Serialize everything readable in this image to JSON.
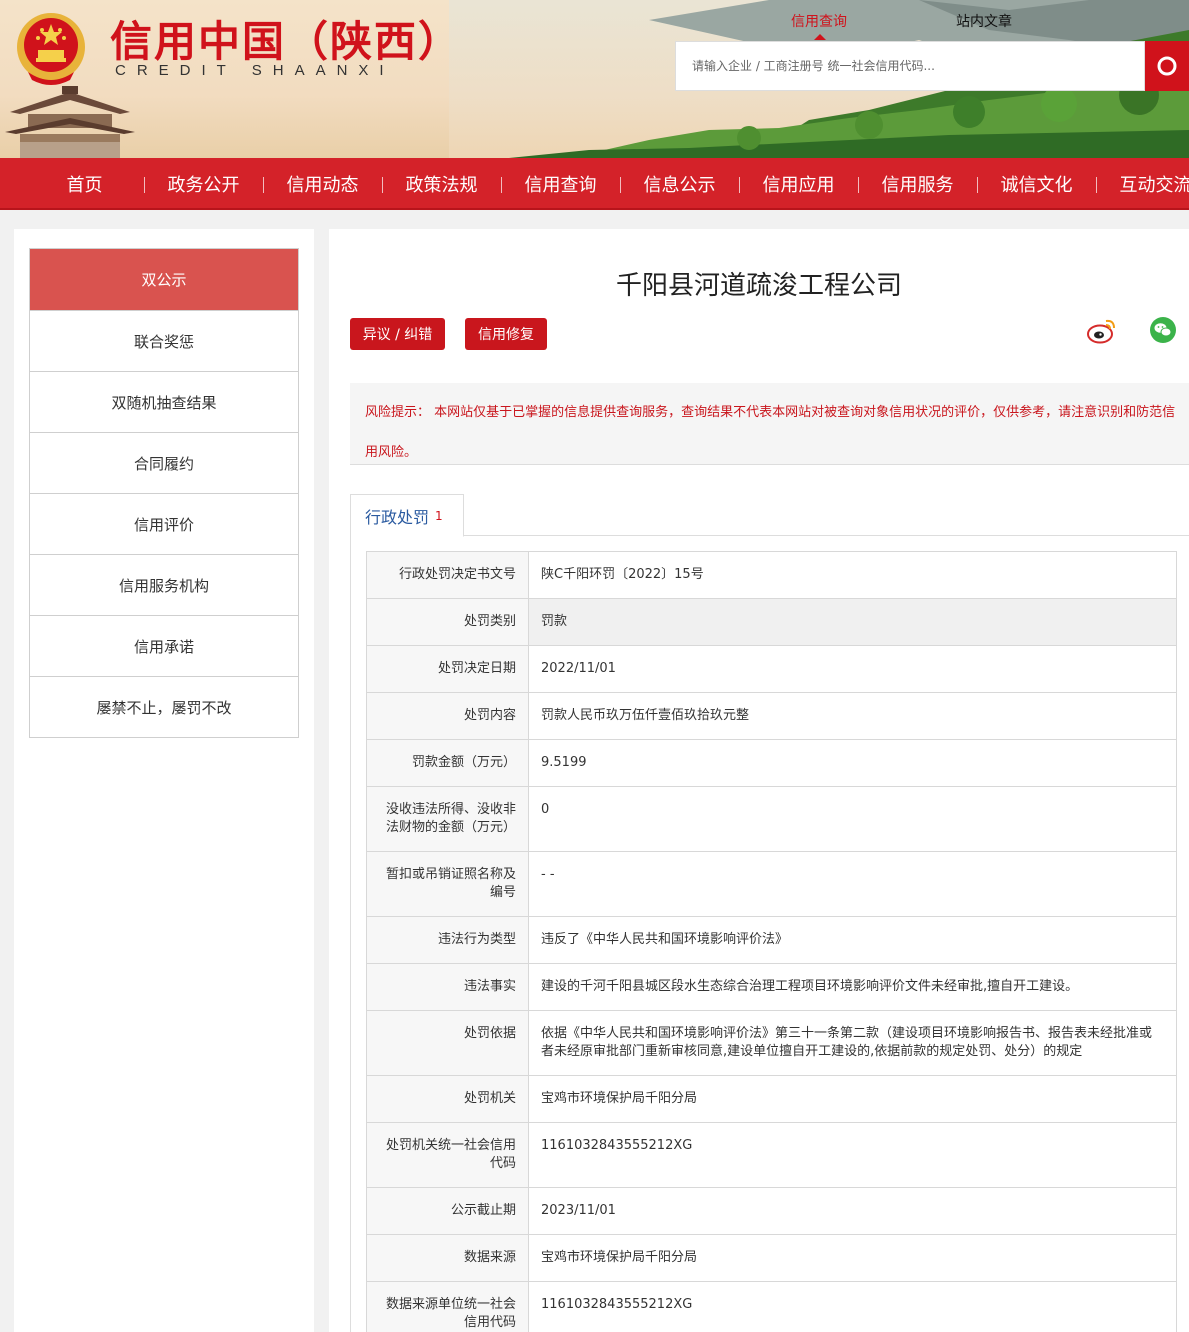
{
  "header": {
    "site_title": "信用中国（陕西）",
    "site_subtitle": "CREDIT SHAANXI",
    "search_tabs": [
      "信用查询",
      "站内文章"
    ],
    "search_placeholder": "请输入企业 / 工商注册号 统一社会信用代码...",
    "search_icon": "search-icon"
  },
  "nav": {
    "items": [
      "首页",
      "政务公开",
      "信用动态",
      "政策法规",
      "信用查询",
      "信息公示",
      "信用应用",
      "信用服务",
      "诚信文化",
      "互动交流"
    ]
  },
  "sidebar": {
    "items": [
      "双公示",
      "联合奖惩",
      "双随机抽查结果",
      "合同履约",
      "信用评价",
      "信用服务机构",
      "信用承诺",
      "屡禁不止，屡罚不改"
    ],
    "active_index": 0
  },
  "main": {
    "company_name": "千阳县河道疏浚工程公司",
    "buttons": {
      "objection": "异议 / 纠错",
      "repair": "信用修复"
    },
    "share_icons": [
      "weibo-icon",
      "wechat-icon"
    ],
    "risk_notice": "风险提示： 本网站仅基于已掌握的信息提供查询服务，查询结果不代表本网站对被查询对象信用状况的评价，仅供参考，请注意识别和防范信用风险。",
    "tab": {
      "label": "行政处罚",
      "count": "1"
    },
    "details": [
      {
        "key": "行政处罚决定书文号",
        "value": "陕C千阳环罚〔2022〕15号"
      },
      {
        "key": "处罚类别",
        "value": "罚款"
      },
      {
        "key": "处罚决定日期",
        "value": "2022/11/01"
      },
      {
        "key": "处罚内容",
        "value": "罚款人民币玖万伍仟壹佰玖拾玖元整"
      },
      {
        "key": "罚款金额（万元）",
        "value": "9.5199"
      },
      {
        "key": "没收违法所得、没收非法财物的金额（万元）",
        "value": "0"
      },
      {
        "key": "暂扣或吊销证照名称及编号",
        "value": "- -"
      },
      {
        "key": "违法行为类型",
        "value": "违反了《中华人民共和国环境影响评价法》"
      },
      {
        "key": "违法事实",
        "value": "建设的千河千阳县城区段水生态综合治理工程项目环境影响评价文件未经审批,擅自开工建设。"
      },
      {
        "key": "处罚依据",
        "value": "依据《中华人民共和国环境影响评价法》第三十一条第二款（建设项目环境影响报告书、报告表未经批准或者未经原审批部门重新审核同意,建设单位擅自开工建设的,依据前款的规定处罚、处分）的规定"
      },
      {
        "key": "处罚机关",
        "value": "宝鸡市环境保护局千阳分局"
      },
      {
        "key": "处罚机关统一社会信用代码",
        "value": "1161032843555212XG"
      },
      {
        "key": "公示截止期",
        "value": "2023/11/01"
      },
      {
        "key": "数据来源",
        "value": "宝鸡市环境保护局千阳分局"
      },
      {
        "key": "数据来源单位统一社会信用代码",
        "value": "1161032843555212XG"
      }
    ]
  },
  "colors": {
    "brand_red": "#d0121b",
    "nav_red": "#d42229",
    "active_side": "#d9534f",
    "link_blue": "#2a5aa0"
  }
}
